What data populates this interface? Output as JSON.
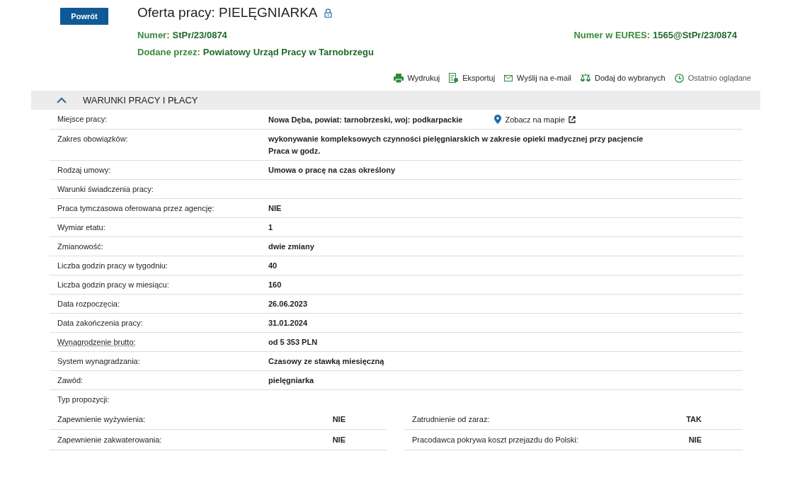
{
  "back_button": "Powrót",
  "title": "Oferta pracy: PIELĘGNIARKA",
  "numer": {
    "label": "Numer:",
    "value": "StPr/23/0874"
  },
  "eures": {
    "label": "Numer w EURES:",
    "value": "1565@StPr/23/0874"
  },
  "added_by": {
    "label": "Dodane przez:",
    "value": "Powiatowy Urząd Pracy w Tarnobrzegu"
  },
  "actions": [
    {
      "kind": "print",
      "label": "Wydrukuj"
    },
    {
      "kind": "export",
      "label": "Eksportuj"
    },
    {
      "kind": "email",
      "label": "Wyślij na e-mail"
    },
    {
      "kind": "compare",
      "label": "Dodaj do wybranych"
    },
    {
      "kind": "history",
      "label": "Ostatnio oglądane"
    }
  ],
  "section": {
    "title": "WARUNKI PRACY I PŁACY",
    "expanded": true
  },
  "rows": [
    {
      "label": "Miejsce pracy:",
      "values": [
        "Nowa Dęba, powiat: tarnobrzeski, woj: podkarpackie"
      ],
      "link": "Zobacz na mapie"
    },
    {
      "label": "Zakres obowiązków:",
      "values": [
        "wykonywanie kompleksowych czynności pielęgniarskich w zakresie opieki madycznej przy pacjencie",
        "Praca w godz."
      ]
    },
    {
      "label": "Rodzaj umowy:",
      "values": [
        "Umowa o pracę na czas określony"
      ]
    },
    {
      "label": "Warunki świadczenia pracy:",
      "values": []
    },
    {
      "label": "Praca tymczasowa oferowana przez agencję:",
      "values": [
        "NIE"
      ]
    },
    {
      "label": "Wymiar etatu:",
      "values": [
        "1"
      ]
    },
    {
      "label": "Zmianowość:",
      "values": [
        "dwie zmiany"
      ]
    },
    {
      "label": "Liczba godzin pracy w tygodniu:",
      "values": [
        "40"
      ]
    },
    {
      "label": "Liczba godzin pracy w miesiącu:",
      "values": [
        "160"
      ]
    },
    {
      "label": "Data rozpoczęcia:",
      "values": [
        "26.06.2023"
      ]
    },
    {
      "label": "Data zakończenia pracy:",
      "values": [
        "31.01.2024"
      ]
    },
    {
      "label": "Wynagrodzenie brutto:",
      "values": [
        "od 5 353 PLN"
      ],
      "hint": true
    },
    {
      "label": "System wynagradzania:",
      "values": [
        "Czasowy ze stawką miesięczną"
      ]
    },
    {
      "label": "Zawód:",
      "values": [
        "pielęgniarka"
      ]
    }
  ],
  "offer_type": {
    "label": "Typ propozycji:",
    "pairs": [
      {
        "label": "Zapewnienie wyżywienia:",
        "value": "NIE"
      },
      {
        "label": "Zatrudnienie od zaraz:",
        "value": "TAK"
      },
      {
        "label": "Zapewnienie zakwaterowania:",
        "value": "NIE"
      },
      {
        "label": "Pracodawca pokrywa koszt przejazdu do Polski:",
        "value": "NIE"
      }
    ]
  }
}
